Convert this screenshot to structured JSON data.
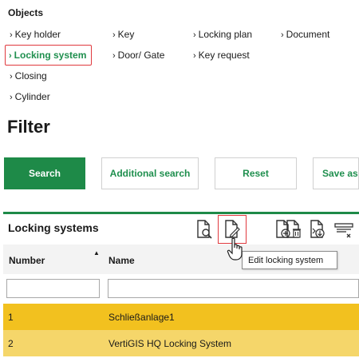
{
  "objects": {
    "title": "Objects",
    "links": [
      {
        "label": "Key holder"
      },
      {
        "label": "Locking system",
        "active": true
      },
      {
        "label": "Closing"
      },
      {
        "label": "Cylinder"
      },
      {
        "label": "Key"
      },
      {
        "label": "Door/ Gate"
      },
      {
        "label": "Locking plan"
      },
      {
        "label": "Key request"
      },
      {
        "label": "Document"
      }
    ]
  },
  "filter": {
    "title": "Filter",
    "buttons": {
      "search": "Search",
      "additional_search": "Additional search",
      "reset": "Reset",
      "save_as": "Save as"
    }
  },
  "panel": {
    "title": "Locking systems",
    "toolbar_icons": [
      "view-document-icon",
      "edit-document-icon",
      "add-document-icon",
      "delete-document-icon",
      "export-document-icon",
      "more-options-icon"
    ],
    "tooltip": "Edit locking system",
    "columns": {
      "number": "Number",
      "name": "Name"
    },
    "sort": "ascending",
    "rows": [
      {
        "number": "1",
        "name": "Schließanlage1"
      },
      {
        "number": "2",
        "name": "VertiGIS HQ Locking System"
      }
    ]
  },
  "colors": {
    "accent": "#1e8a48",
    "highlight": "#e0393e",
    "row_selected": "#f2c11f",
    "row_secondary": "#f5d66a"
  }
}
